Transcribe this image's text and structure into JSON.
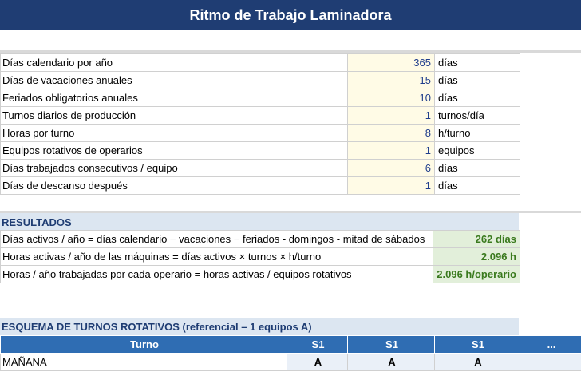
{
  "title": "Ritmo de Trabajo Laminadora",
  "inputs": [
    {
      "label": "Días calendario por año",
      "value": "365",
      "unit": "días"
    },
    {
      "label": "Días de vacaciones anuales",
      "value": "15",
      "unit": "días"
    },
    {
      "label": "Feriados obligatorios anuales",
      "value": "10",
      "unit": "días"
    },
    {
      "label": "Turnos diarios de producción",
      "value": "1",
      "unit": "turnos/día"
    },
    {
      "label": "Horas por turno",
      "value": "8",
      "unit": "h/turno"
    },
    {
      "label": "Equipos rotativos de operarios",
      "value": "1",
      "unit": "equipos"
    },
    {
      "label": "Días trabajados consecutivos / equipo",
      "value": "6",
      "unit": "días"
    },
    {
      "label": "Días de descanso después",
      "value": "1",
      "unit": "días"
    }
  ],
  "results_title": "RESULTADOS",
  "results": [
    {
      "label": "Días activos / año = días calendario − vacaciones − feriados - domingos - mitad de sábados",
      "value": "262 días"
    },
    {
      "label": "Horas activas / año de las máquinas = días activos × turnos × h/turno",
      "value": "2.096 h"
    },
    {
      "label": "Horas / año trabajadas por cada operario = horas activas / equipos rotativos",
      "value": "2.096 h/operario"
    }
  ],
  "schema_title": "ESQUEMA DE TURNOS ROTATIVOS  (referencial – 1 equipos A)",
  "schema_header": [
    "Turno",
    "S1",
    "S1",
    "S1",
    "..."
  ],
  "schema_rows": [
    {
      "turno": "MAÑANA",
      "cells": [
        "A",
        "A",
        "A",
        ""
      ]
    }
  ]
}
